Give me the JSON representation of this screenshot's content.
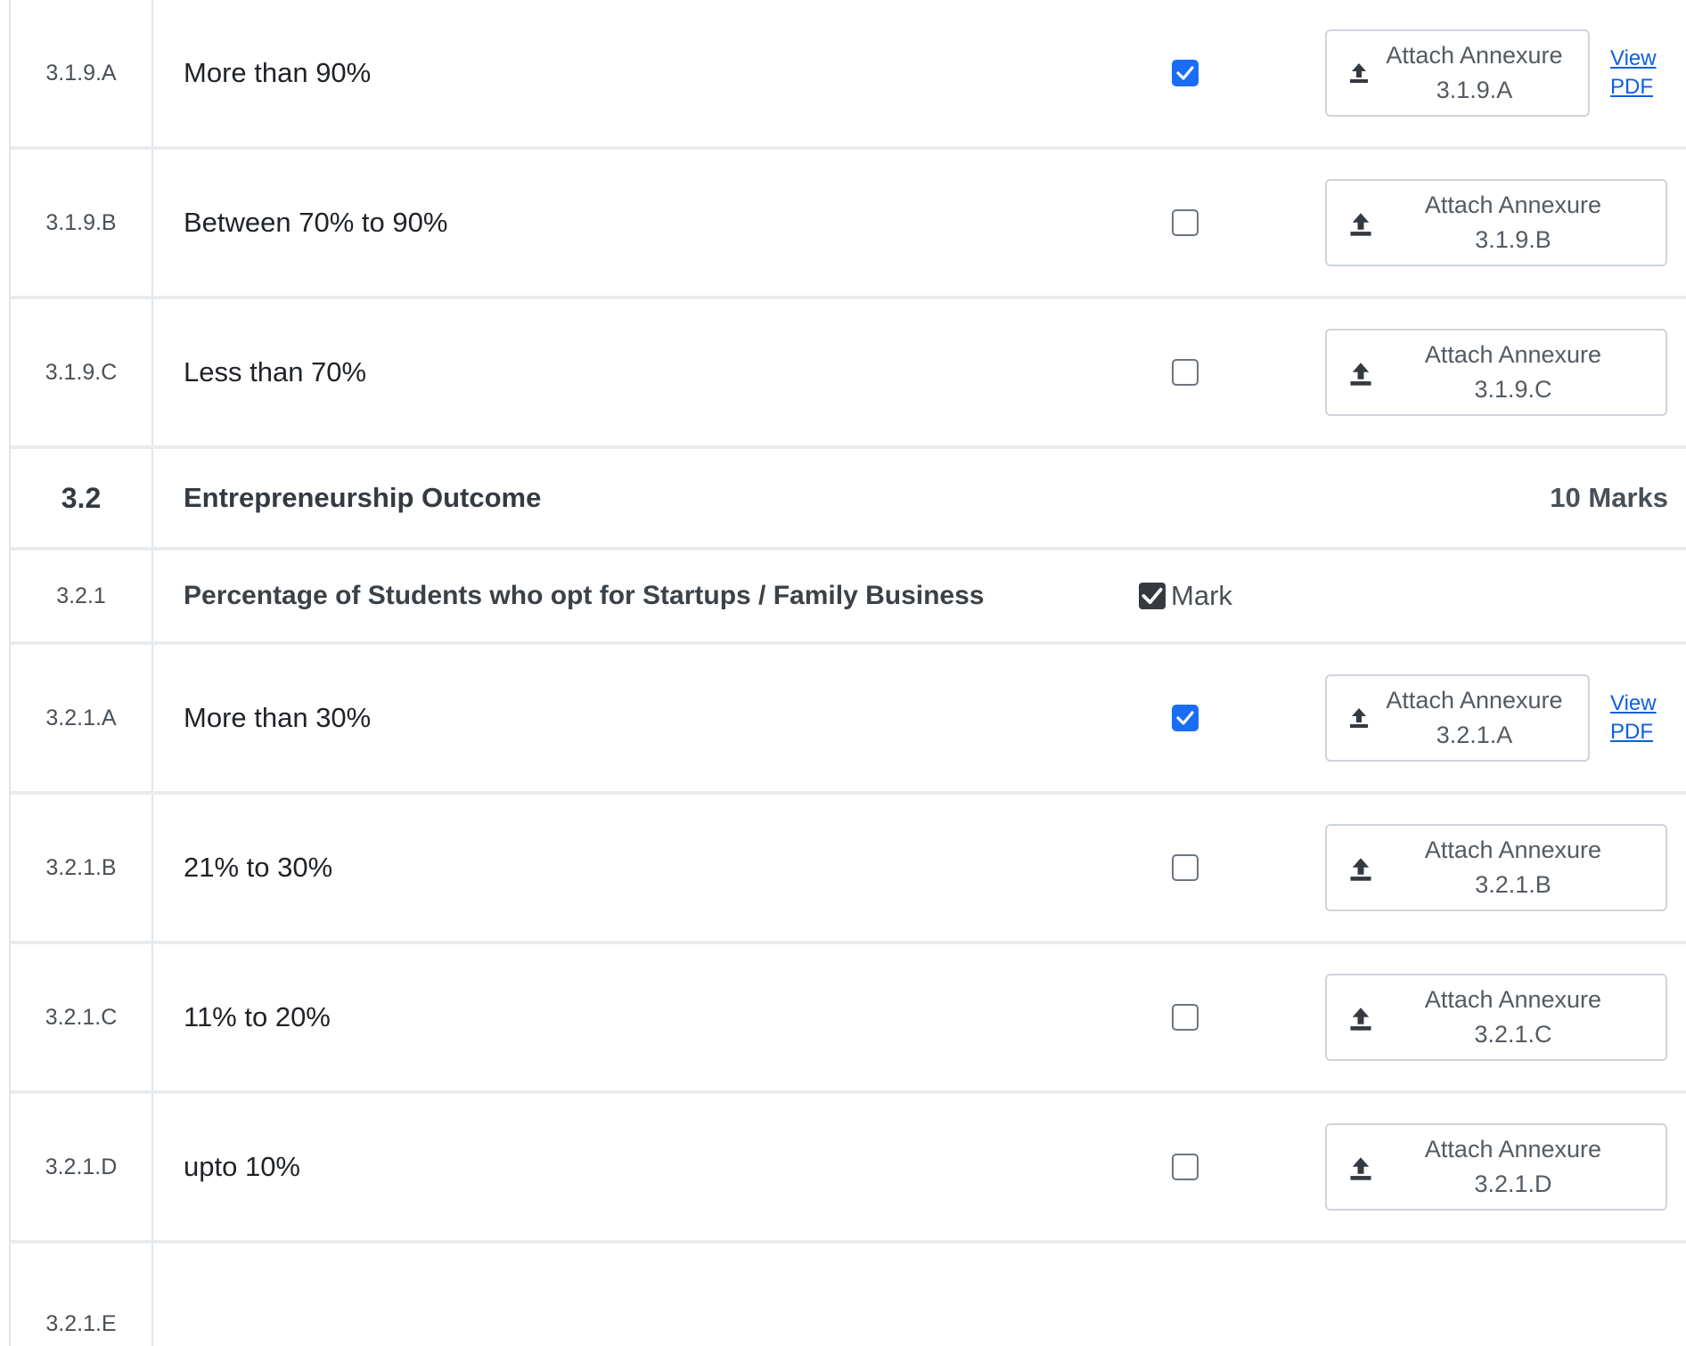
{
  "rows": [
    {
      "type": "option",
      "code": "3.1.9.A",
      "label": "More than 90%",
      "checked": true,
      "attach_line1": "Attach Annexure",
      "attach_line2": "3.1.9.A",
      "view_line1": "View",
      "view_line2": "PDF"
    },
    {
      "type": "option",
      "code": "3.1.9.B",
      "label": "Between 70% to 90%",
      "checked": false,
      "attach_line1": "Attach Annexure",
      "attach_line2": "3.1.9.B"
    },
    {
      "type": "option",
      "code": "3.1.9.C",
      "label": "Less than 70%",
      "checked": false,
      "attach_line1": "Attach Annexure",
      "attach_line2": "3.1.9.C"
    },
    {
      "type": "section",
      "code": "3.2",
      "label": "Entrepreneurship Outcome",
      "marks": "10 Marks"
    },
    {
      "type": "question",
      "code": "3.2.1",
      "label": "Percentage of Students who opt for Startups / Family Business",
      "mark_label": "Mark",
      "mark_checked": true
    },
    {
      "type": "option",
      "code": "3.2.1.A",
      "label": "More than 30%",
      "checked": true,
      "attach_line1": "Attach Annexure",
      "attach_line2": "3.2.1.A",
      "view_line1": "View",
      "view_line2": "PDF"
    },
    {
      "type": "option",
      "code": "3.2.1.B",
      "label": "21% to 30%",
      "checked": false,
      "attach_line1": "Attach Annexure",
      "attach_line2": "3.2.1.B"
    },
    {
      "type": "option",
      "code": "3.2.1.C",
      "label": "11% to 20%",
      "checked": false,
      "attach_line1": "Attach Annexure",
      "attach_line2": "3.2.1.C"
    },
    {
      "type": "option",
      "code": "3.2.1.D",
      "label": "upto 10%",
      "checked": false,
      "attach_line1": "Attach Annexure",
      "attach_line2": "3.2.1.D"
    },
    {
      "type": "partial",
      "code": "3.2.1.E"
    }
  ],
  "colors": {
    "accent": "#1a6ef5",
    "link": "#0d5fe0",
    "border": "#e9ecef"
  }
}
